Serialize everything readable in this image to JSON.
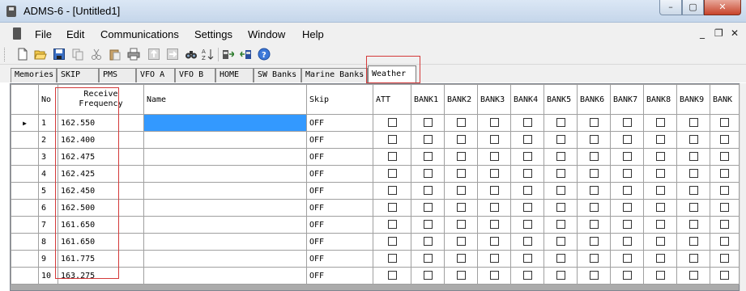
{
  "window": {
    "title": "ADMS-6 - [Untitled1]",
    "minimize": "–",
    "maximize": "▢",
    "close": "✕"
  },
  "menu": {
    "items": [
      "File",
      "Edit",
      "Communications",
      "Settings",
      "Window",
      "Help"
    ],
    "mdi_min": "_",
    "mdi_restore": "❐",
    "mdi_close": "✕"
  },
  "toolbar": {
    "icons": [
      "new-icon",
      "open-icon",
      "save-icon",
      "copy-icon",
      "cut-icon",
      "paste-icon",
      "print-icon",
      "import-icon",
      "export-icon",
      "find-icon",
      "sort-icon",
      "read-radio-icon",
      "write-radio-icon",
      "help-icon"
    ]
  },
  "tabs": [
    "Memories",
    "SKIP",
    "PMS",
    "VFO A",
    "VFO B",
    "HOME",
    "SW Banks",
    "Marine Banks",
    "Weather"
  ],
  "active_tab": "Weather",
  "grid": {
    "headers": {
      "no": "No",
      "receive_frequency": "Receive\nFrequency",
      "name": "Name",
      "skip": "Skip",
      "att": "ATT",
      "banks": [
        "BANK1",
        "BANK2",
        "BANK3",
        "BANK4",
        "BANK5",
        "BANK6",
        "BANK7",
        "BANK8",
        "BANK9",
        "BANK"
      ]
    },
    "rows": [
      {
        "no": "1",
        "freq": "162.550",
        "name": "",
        "skip": "OFF"
      },
      {
        "no": "2",
        "freq": "162.400",
        "name": "",
        "skip": "OFF"
      },
      {
        "no": "3",
        "freq": "162.475",
        "name": "",
        "skip": "OFF"
      },
      {
        "no": "4",
        "freq": "162.425",
        "name": "",
        "skip": "OFF"
      },
      {
        "no": "5",
        "freq": "162.450",
        "name": "",
        "skip": "OFF"
      },
      {
        "no": "6",
        "freq": "162.500",
        "name": "",
        "skip": "OFF"
      },
      {
        "no": "7",
        "freq": "161.650",
        "name": "",
        "skip": "OFF"
      },
      {
        "no": "8",
        "freq": "161.650",
        "name": "",
        "skip": "OFF"
      },
      {
        "no": "9",
        "freq": "161.775",
        "name": "",
        "skip": "OFF"
      },
      {
        "no": "10",
        "freq": "163.275",
        "name": "",
        "skip": "OFF"
      }
    ],
    "current_row_marker": "▶"
  },
  "colors": {
    "selection": "#3399ff",
    "annotation": "#d43a3a"
  }
}
